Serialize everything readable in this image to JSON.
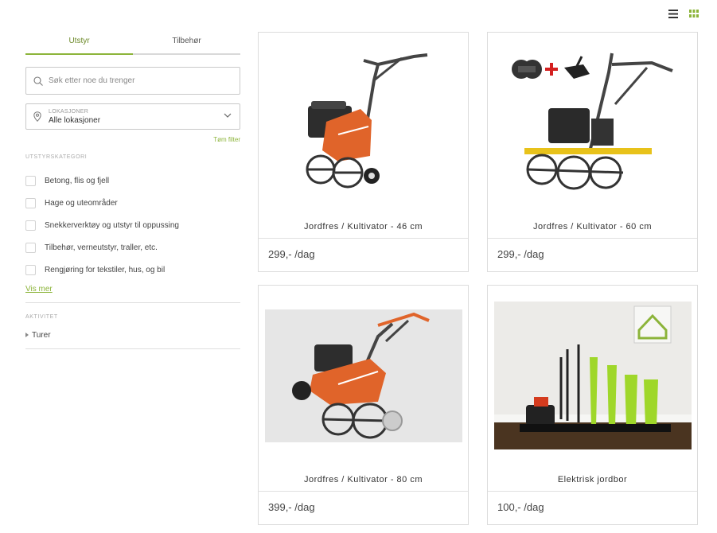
{
  "view_toggles": {
    "list_icon": "list-icon",
    "grid_icon": "grid-icon"
  },
  "tabs": [
    {
      "label": "Utstyr",
      "active": true
    },
    {
      "label": "Tilbehør",
      "active": false
    }
  ],
  "search": {
    "placeholder": "Søk etter noe du trenger",
    "value": ""
  },
  "location": {
    "label": "LOKASJONER",
    "value": "Alle lokasjoner"
  },
  "clear_filter": "Tøm filter",
  "category": {
    "title": "UTSTYRSKATEGORI",
    "items": [
      "Betong, flis og fjell",
      "Hage og uteområder",
      "Snekkerverktøy og utstyr til oppussing",
      "Tilbehør, verneutstyr, traller, etc.",
      "Rengjøring for tekstiler, hus, og bil"
    ],
    "show_more": "Vis mer"
  },
  "activity": {
    "title": "AKTIVITET",
    "items": [
      "Turer"
    ]
  },
  "products": [
    {
      "title": "Jordfres / Kultivator - 46 cm",
      "price": "299,- /dag"
    },
    {
      "title": "Jordfres / Kultivator - 60 cm",
      "price": "299,- /dag"
    },
    {
      "title": "Jordfres / Kultivator - 80 cm",
      "price": "399,- /dag"
    },
    {
      "title": "Elektrisk jordbor",
      "price": "100,- /dag"
    }
  ],
  "colors": {
    "accent": "#8cb43a",
    "husqvarna_orange": "#e0642a"
  }
}
